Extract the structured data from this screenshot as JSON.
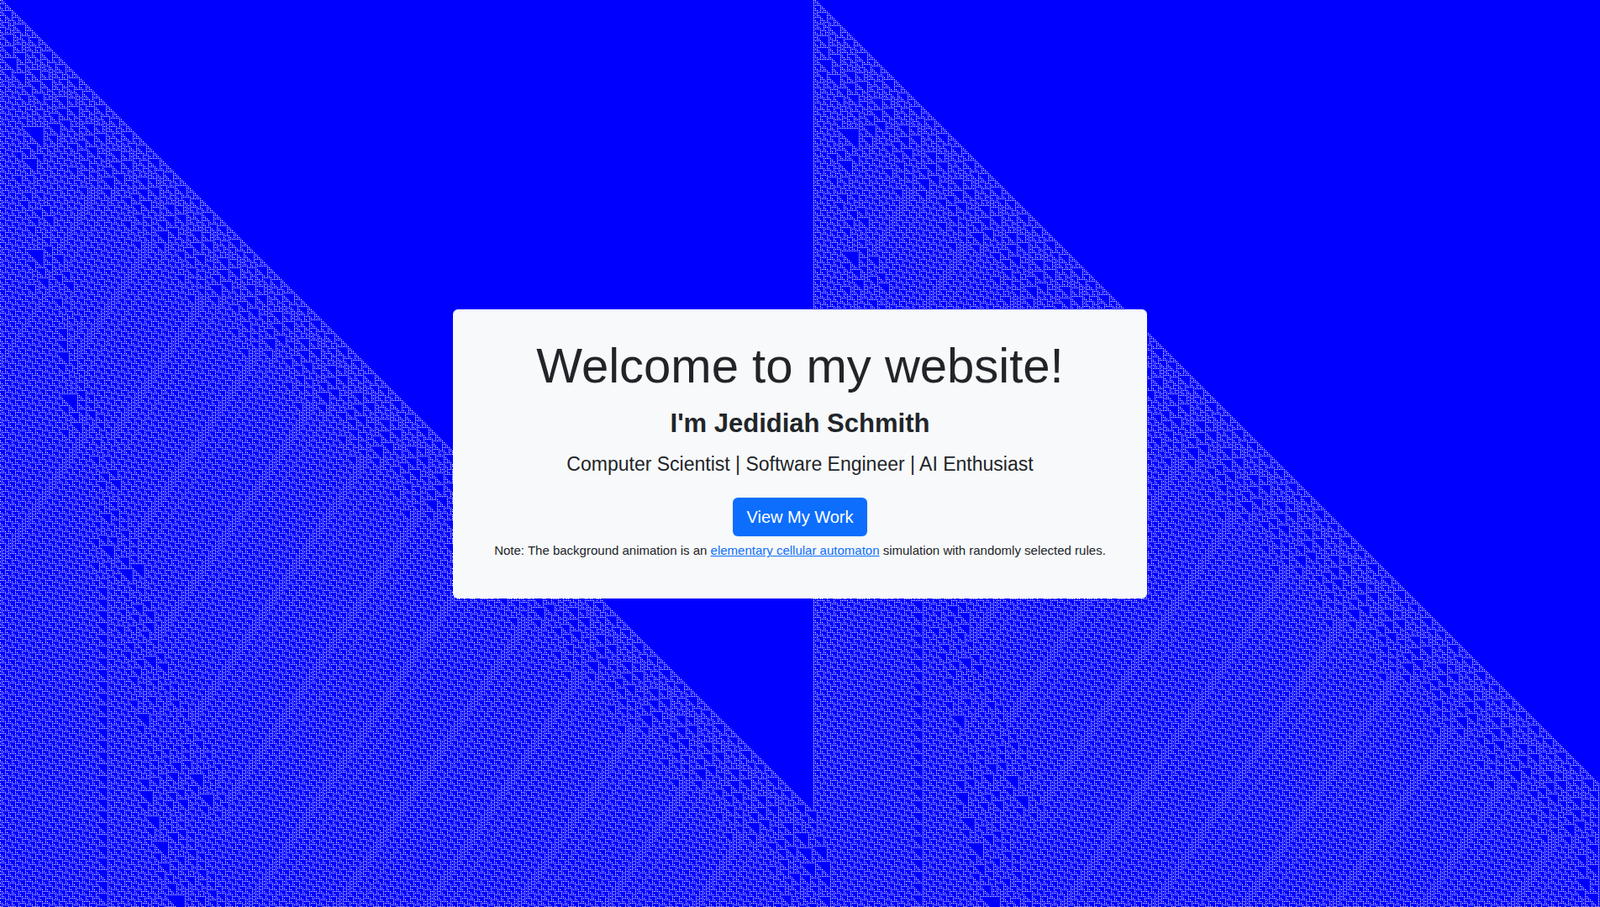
{
  "card": {
    "title": "Welcome to my website!",
    "name": "I'm Jedidiah Schmith",
    "subtitle": "Computer Scientist | Software Engineer | AI Enthusiast",
    "button": "View My Work",
    "note": {
      "before": "Note: The background animation is an ",
      "link": "elementary cellular automaton",
      "after": " simulation with randomly selected rules."
    }
  }
}
